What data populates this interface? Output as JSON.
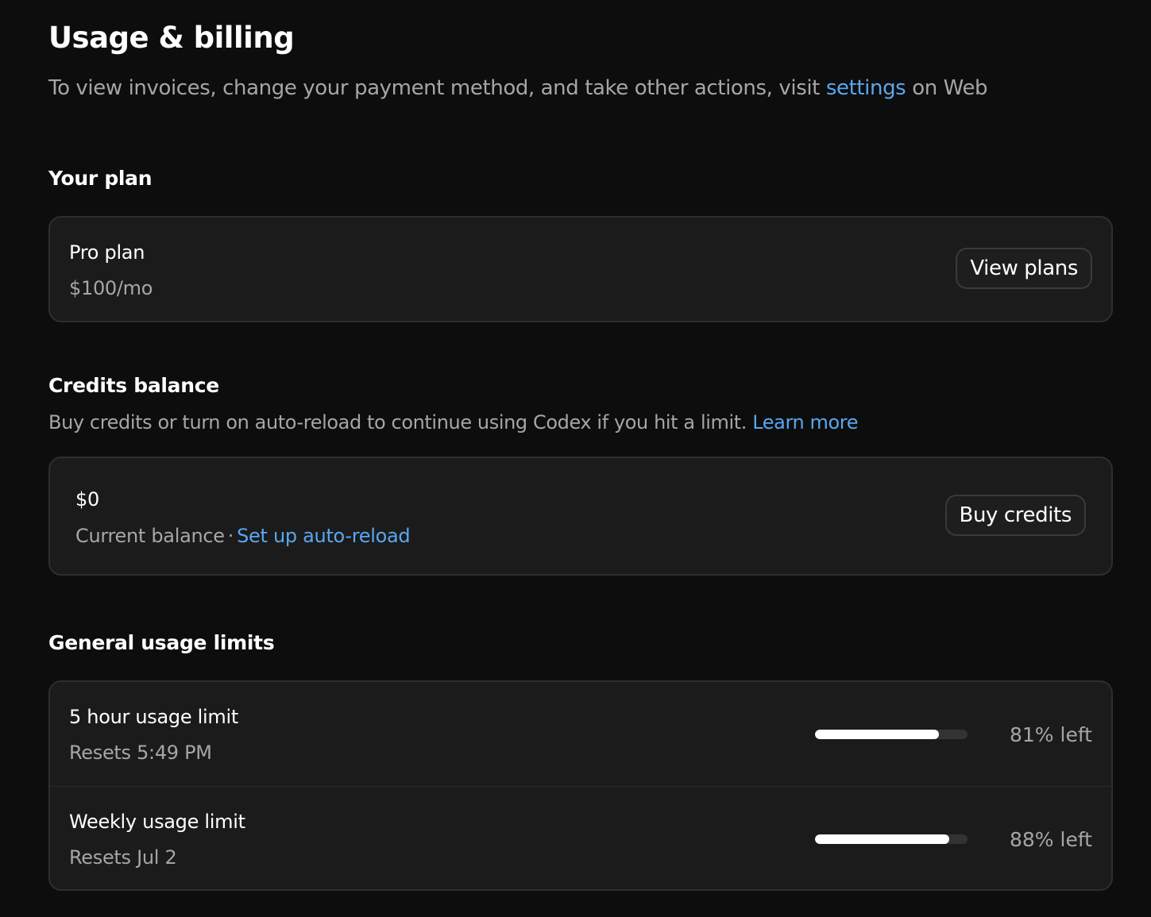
{
  "header": {
    "title": "Usage & billing",
    "subtitle_prefix": "To view invoices, change your payment method, and take other actions, visit",
    "subtitle_link": "settings",
    "subtitle_suffix": "on Web"
  },
  "plan": {
    "section_title": "Your plan",
    "name": "Pro plan",
    "price": "$100/mo",
    "button_label": "View plans"
  },
  "credits": {
    "section_title": "Credits balance",
    "description": "Buy credits or turn on auto-reload to continue using Codex if you hit a limit.",
    "learn_more": "Learn more",
    "amount": "$0",
    "balance_label": "Current balance",
    "separator": "·",
    "auto_reload_link": "Set up auto-reload",
    "button_label": "Buy credits"
  },
  "usage": {
    "section_title": "General usage limits",
    "limits": [
      {
        "name": "5 hour usage limit",
        "reset": "Resets 5:49 PM",
        "remaining_fraction": 0.81,
        "remaining_label": "81% left"
      },
      {
        "name": "Weekly usage limit",
        "reset": "Resets Jul 2",
        "remaining_fraction": 0.88,
        "remaining_label": "88% left"
      }
    ]
  },
  "colors": {
    "background": "#0d0d0d",
    "card": "#1b1b1b",
    "link": "#5aa6f0",
    "muted_text": "#a6a6a6"
  }
}
